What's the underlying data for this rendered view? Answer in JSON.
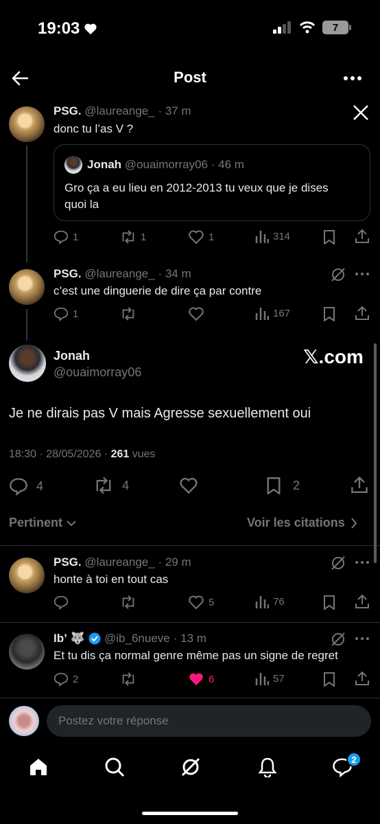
{
  "status_bar": {
    "time": "19:03",
    "battery": "7"
  },
  "header": {
    "title": "Post"
  },
  "reply1": {
    "name": "PSG.",
    "handle": "@laureange_",
    "time": "· 37 m",
    "text": "donc tu l’as V ?",
    "quote": {
      "name": "Jonah",
      "handle": "@ouaimorray06",
      "time": "· 46 m",
      "text_line1": "Gro ça a eu lieu en 2012-2013 tu veux que je dises",
      "text_line2": "quoi la"
    },
    "stats": {
      "replies": "1",
      "reposts": "1",
      "likes": "1",
      "views": "314"
    }
  },
  "reply2": {
    "name": "PSG.",
    "handle": "@laureange_",
    "time": "· 34 m",
    "text": "c’est une dinguerie de dire ça par contre",
    "stats": {
      "replies": "1",
      "reposts": "",
      "likes": "",
      "views": "167"
    }
  },
  "main_post": {
    "name": "Jonah",
    "handle": "@ouaimorray06",
    "brand": "𝕏.com",
    "text": "Je ne dirais pas V mais Agresse sexuellement oui",
    "timestamp": "18:30 · 28/05/2026 · ",
    "views_count": "261",
    "views_label": " vues",
    "stats": {
      "replies": "4",
      "reposts": "4",
      "bookmarks": "2"
    }
  },
  "sort": {
    "label": "Pertinent",
    "quotes_link": "Voir les citations"
  },
  "reply3": {
    "name": "PSG.",
    "handle": "@laureange_",
    "time": "· 29 m",
    "text": "honte à toi en tout cas",
    "stats": {
      "replies": "",
      "reposts": "",
      "likes": "5",
      "views": "76"
    }
  },
  "reply4": {
    "name": "Ib’",
    "emoji": "🐺",
    "handle": "@ib_6nueve",
    "time": "· 13 m",
    "text": "Et tu dis ça normal genre même pas un signe de regret",
    "stats": {
      "replies": "2",
      "reposts": "",
      "likes": "6",
      "views": "57"
    }
  },
  "composer": {
    "placeholder": "Postez votre réponse"
  },
  "bottom_nav": {
    "messages_badge": "2"
  },
  "colors": {
    "accent": "#1d9bf0",
    "like": "#f91880",
    "muted": "#71767b"
  }
}
